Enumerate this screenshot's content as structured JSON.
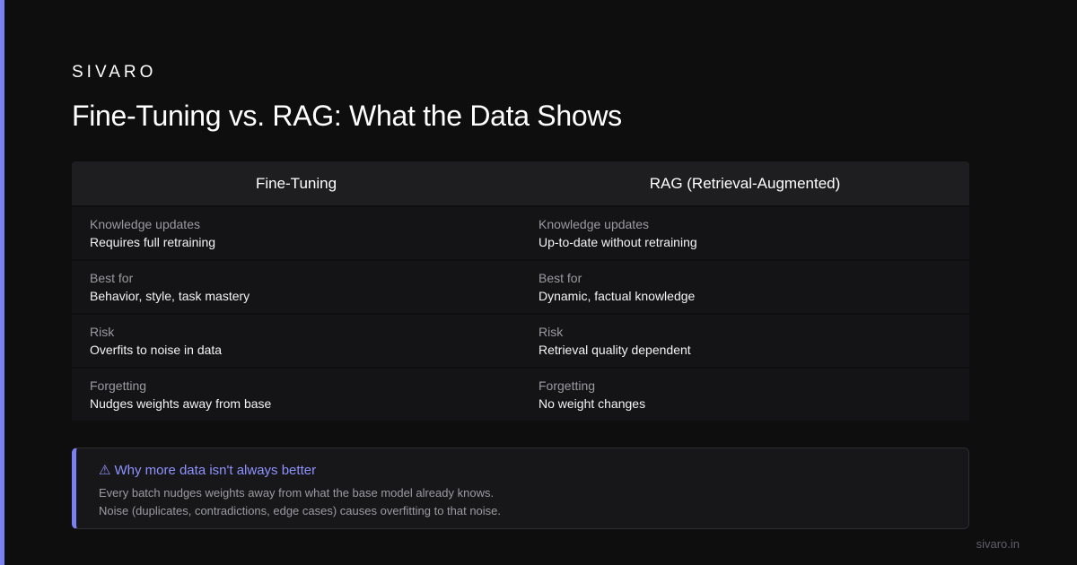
{
  "brand": "SIVARO",
  "title": "Fine-Tuning vs. RAG: What the Data Shows",
  "colors": {
    "background": "#0e0e0f",
    "accent": "#7b7ff2",
    "callout_title": "#8f93ff"
  },
  "table": {
    "columns": [
      {
        "header": "Fine-Tuning",
        "rows": [
          {
            "label": "Knowledge updates",
            "value": "Requires full retraining"
          },
          {
            "label": "Best for",
            "value": "Behavior, style, task mastery"
          },
          {
            "label": "Risk",
            "value": "Overfits to noise in data"
          },
          {
            "label": "Forgetting",
            "value": "Nudges weights away from base"
          }
        ]
      },
      {
        "header": "RAG (Retrieval-Augmented)",
        "rows": [
          {
            "label": "Knowledge updates",
            "value": "Up-to-date without retraining"
          },
          {
            "label": "Best for",
            "value": "Dynamic, factual knowledge"
          },
          {
            "label": "Risk",
            "value": "Retrieval quality dependent"
          },
          {
            "label": "Forgetting",
            "value": "No weight changes"
          }
        ]
      }
    ]
  },
  "callout": {
    "icon": "warning-icon",
    "title": "Why more data isn't always better",
    "lines": [
      "Every batch nudges weights away from what the base model already knows.",
      "Noise (duplicates, contradictions, edge cases) causes overfitting to that noise."
    ]
  },
  "footer": "sivaro.in"
}
